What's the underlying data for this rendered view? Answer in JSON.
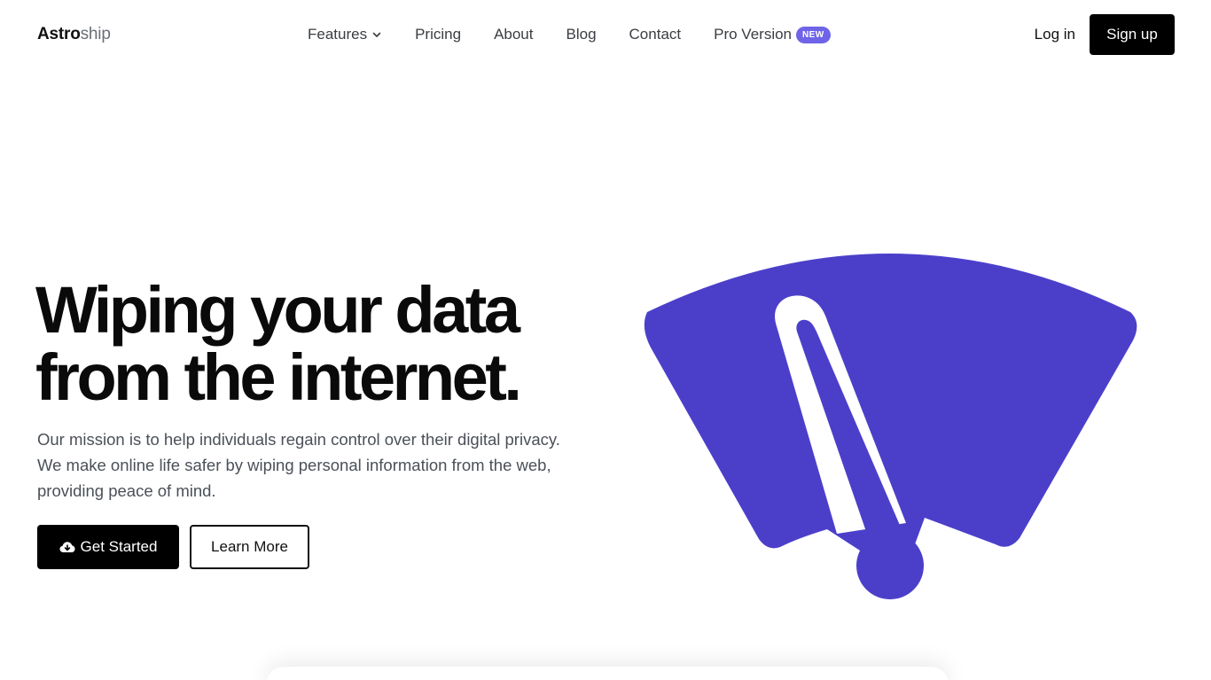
{
  "brand": {
    "name_strong": "Astro",
    "name_light": "ship"
  },
  "nav": {
    "items": [
      {
        "label": "Features",
        "has_dropdown": true
      },
      {
        "label": "Pricing"
      },
      {
        "label": "About"
      },
      {
        "label": "Blog"
      },
      {
        "label": "Contact"
      },
      {
        "label": "Pro Version",
        "badge": "NEW"
      }
    ]
  },
  "auth": {
    "login_label": "Log in",
    "signup_label": "Sign up"
  },
  "hero": {
    "title_line1": "Wiping your data",
    "title_line2": "from the internet.",
    "description": "Our mission is to help individuals regain control over their digital privacy. We make online life safer by wiping personal information from the web, providing peace of mind.",
    "primary_cta": "Get Started",
    "primary_cta_icon": "cloud-download-icon",
    "secondary_cta": "Learn More"
  },
  "illustration": {
    "icon": "gauge-wiper-icon"
  },
  "colors": {
    "accent": "#4b3fca",
    "badge": "#6f64e8",
    "primary_button": "#000000",
    "text_muted": "#4b5058"
  }
}
